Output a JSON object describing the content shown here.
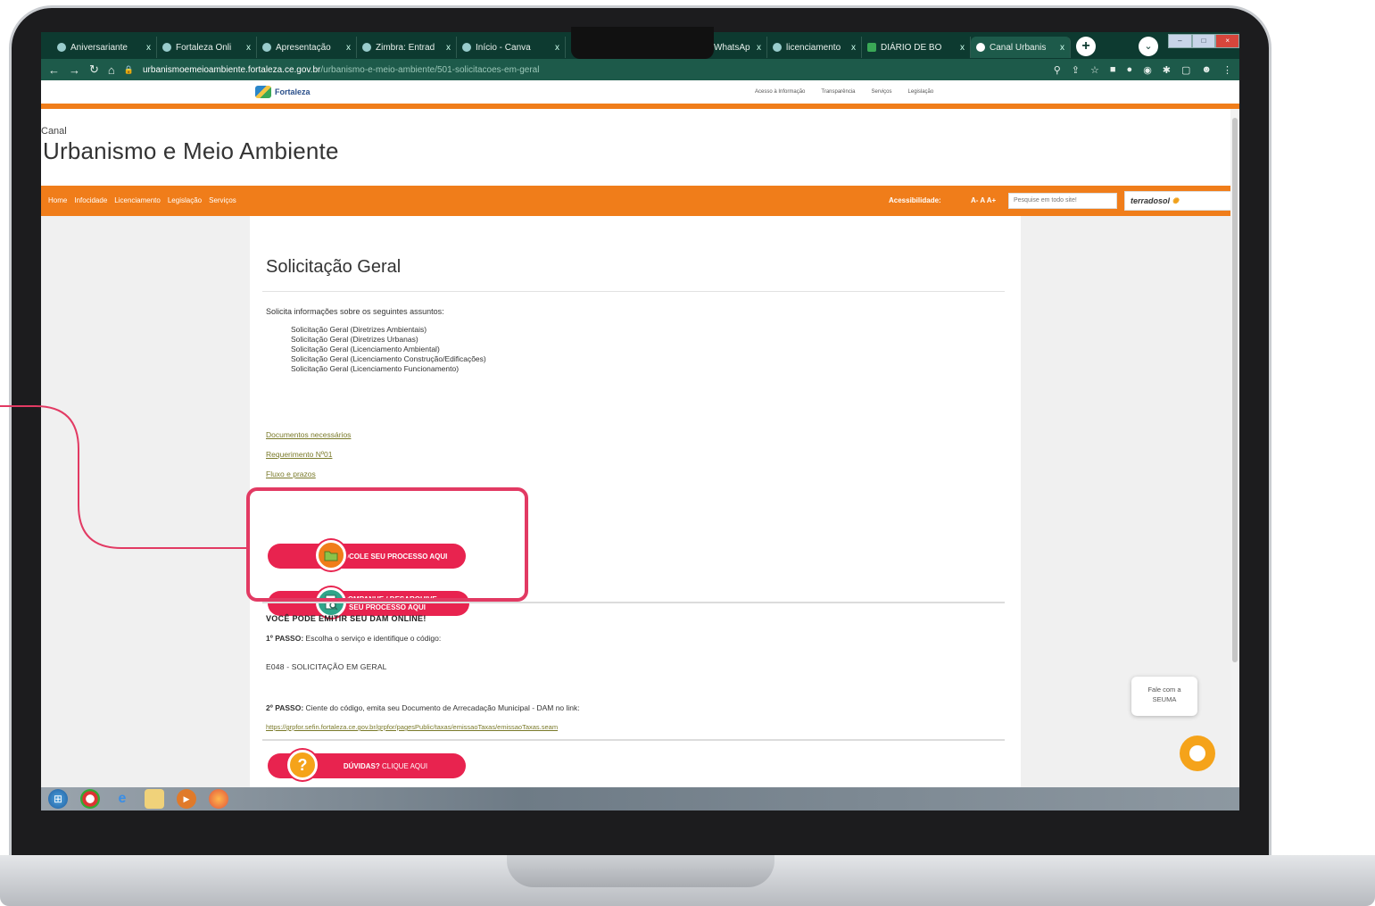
{
  "browser": {
    "tabs": [
      {
        "label": "Aniversariante"
      },
      {
        "label": "Fortaleza Onli"
      },
      {
        "label": "Apresentação"
      },
      {
        "label": "Zimbra: Entrad"
      },
      {
        "label": "Início - Canva"
      },
      {
        "label": "WhatsAp"
      },
      {
        "label": "licenciamento"
      },
      {
        "label": "DIÁRIO DE BO"
      },
      {
        "label": "Canal Urbanis"
      }
    ],
    "close_glyph": "x",
    "url_host": "urbanismoemeioambiente.fortaleza.ce.gov.br",
    "url_path": "/urbanismo-e-meio-ambiente/501-solicitacoes-em-geral"
  },
  "portal": {
    "logo_text": "Fortaleza",
    "top_links": [
      "Acesso à Informação",
      "Transparência",
      "Serviços",
      "Legislação"
    ]
  },
  "channel": {
    "label": "Canal",
    "title": "Urbanismo e Meio Ambiente"
  },
  "nav": {
    "items": [
      "Home",
      "Infocidade",
      "Licenciamento",
      "Legislação",
      "Serviços"
    ],
    "accessibility_label": "Acessibilidade:",
    "font_controls": "A- A A+",
    "search_placeholder": "Pesquise em todo site!",
    "terra_brand": "terradosol"
  },
  "content": {
    "page_title": "Solicitação Geral",
    "intro": "Solicita informações sobre os seguintes assuntos:",
    "subjects": [
      "Solicitação Geral (Diretrizes Ambientais)",
      "Solicitação Geral (Diretrizes Urbanas)",
      "Solicitação Geral (Licenciamento Ambiental)",
      "Solicitação Geral (Licenciamento Construção/Edificações)",
      "Solicitação Geral (Licenciamento Funcionamento)"
    ],
    "links": [
      "Documentos necessários",
      "Requerimento Nº01",
      "Fluxo e prazos"
    ],
    "btn_protocol": "PROTOCOLE SEU PROCESSO AQUI",
    "btn_follow_line1": "ACOMPANHE / DESARQUIVE",
    "btn_follow_line2": "SEU PROCESSO AQUI",
    "dam_title": "VOCÊ PODE EMITIR SEU DAM ONLINE!",
    "step1_label": "1º PASSO:",
    "step1_text": "Escolha o serviço e identifique o código:",
    "service_code": "E048 - SOLICITAÇÃO EM GERAL",
    "step2_label": "2º PASSO:",
    "step2_text": "Ciente do código, emita seu Documento de Arrecadação Municipal - DAM no link:",
    "dam_link": "https://grpfor.sefin.fortaleza.ce.gov.br/grpfor/pagesPublic/taxas/emissaoTaxas/emissaoTaxas.seam",
    "help_bold": "DÚVIDAS?",
    "help_text": "CLIQUE AQUI"
  },
  "chat": {
    "line1": "Fale com a",
    "line2": "SEUMA"
  },
  "colors": {
    "orange": "#f07d1a",
    "pink": "#e8234f",
    "highlight": "#e23a63",
    "browser_green": "#0d3a30"
  }
}
